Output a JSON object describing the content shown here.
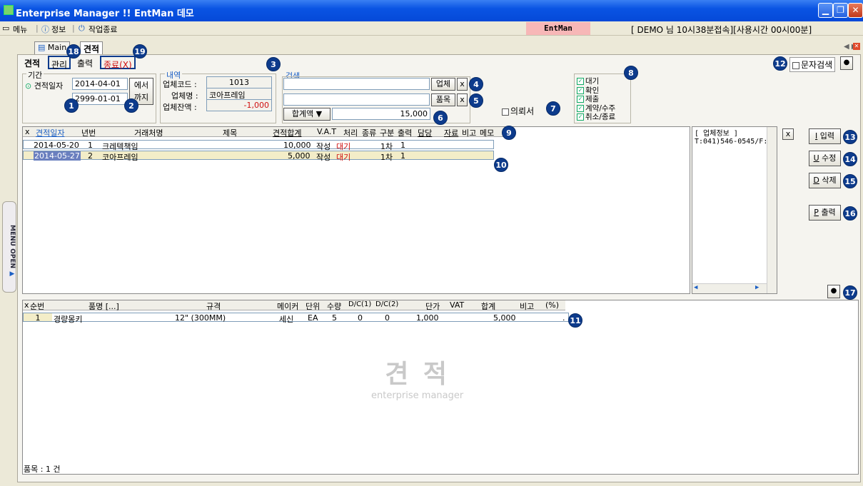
{
  "window": {
    "title": "Enterprise Manager !! EntMan 데모"
  },
  "menubar": {
    "menu": "메뉴",
    "info": "정보",
    "exit": "작업종료",
    "brand": "EntMan",
    "user": "[ DEMO 님 10시38분접속][사용시간 00시00분]"
  },
  "tabs": {
    "main": "Main",
    "estimate": "견적"
  },
  "subtabs": {
    "estimate": "견적",
    "manage": "관리",
    "print": "출력",
    "close": "종료(X)"
  },
  "period": {
    "legend": "기간",
    "label": "견적일자",
    "from": "2014-04-01",
    "to": "2999-01-01",
    "from_suffix": "에서",
    "to_suffix": "까지"
  },
  "detail": {
    "legend": "내역",
    "code_label": "업체코드 :",
    "code": "1013",
    "name_label": "업체명 :",
    "name": "코아프레임",
    "balance_label": "업체잔액 :",
    "balance": "-1,000"
  },
  "search": {
    "legend": "검색",
    "vendor_btn": "업체",
    "item_btn": "품목",
    "clear": "x",
    "total_btn": "합계액 ▼",
    "total": "15,000",
    "request_label": "의뢰서"
  },
  "status_filters": [
    "대기",
    "확인",
    "제출",
    "계약/수주",
    "취소/종료"
  ],
  "text_search": "문자검색",
  "grid1": {
    "headers": [
      "x",
      "견적일자",
      "년번",
      "거래처명",
      "제목",
      "견적합계",
      "V.A.T",
      "처리",
      "종류",
      "구분",
      "출력",
      "담당",
      "자료",
      "비고",
      "메모"
    ],
    "rows": [
      {
        "date": "2014-05-20",
        "no": "1",
        "client": "크레텍책임",
        "title": "",
        "total": "10,000",
        "proc": "작성",
        "status": "대기",
        "kind": "1차",
        "out": "1"
      },
      {
        "date": "2014-05-27",
        "no": "2",
        "client": "코아프레임",
        "title": "",
        "total": "5,000",
        "proc": "작성",
        "status": "대기",
        "kind": "1차",
        "out": "1"
      }
    ]
  },
  "infobox": {
    "title": "[ 업체정보 ]",
    "phone": "T:041)546-0545/F:"
  },
  "buttons": {
    "input": "입력",
    "edit": "수정",
    "delete": "삭제",
    "print": "출력",
    "input_key": "I",
    "edit_key": "U",
    "delete_key": "D",
    "print_key": "P"
  },
  "grid2": {
    "headers": [
      "x",
      "순번",
      "품명 [...]",
      "규격",
      "메이커",
      "단위",
      "수량",
      "D/C(1)",
      "D/C(2)",
      "단가",
      "VAT",
      "합계",
      "비고",
      "(%)"
    ],
    "rows": [
      {
        "seq": "1",
        "name": "경량몽키",
        "spec": "12\" (300MM)",
        "maker": "세신",
        "unit": "EA",
        "qty": "5",
        "dc1": "0",
        "dc2": "0",
        "price": "1,000",
        "vat": "",
        "sum": "5,000",
        "note": "",
        "pct": "."
      }
    ]
  },
  "watermark": {
    "title": "견 적",
    "sub": "enterprise manager"
  },
  "footer": {
    "count": "품목 : 1 건"
  },
  "sidebar": {
    "menu_open": "MENU OPEN"
  },
  "badges": [
    "1",
    "2",
    "3",
    "4",
    "5",
    "6",
    "7",
    "8",
    "9",
    "10",
    "11",
    "12",
    "13",
    "14",
    "15",
    "16",
    "17",
    "18",
    "19"
  ],
  "colors": {
    "title_bar": "#0a54e3",
    "status_red": "#d01010",
    "selected_row": "#f3edc8",
    "badge": "#0d3b8c"
  }
}
